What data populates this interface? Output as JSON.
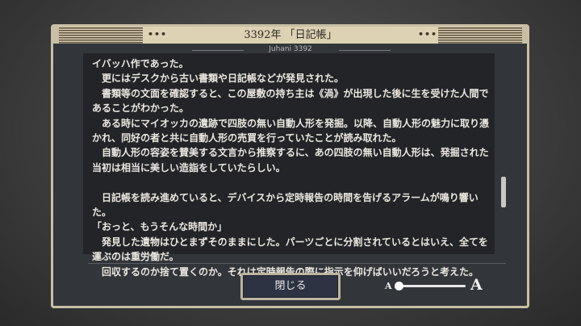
{
  "dialog": {
    "title": "3392年 「日記帳」",
    "subtitle": "Juhani 3392",
    "paragraphs": [
      "イバッハ作であった。",
      "　更にはデスクから古い書類や日記帳などが発見された。",
      "　書類等の文面を確認すると、この屋敷の持ち主は《渦》が出現した後に生を受けた人間であることがわかった。",
      "　ある時にマイオッカの遺跡で四肢の無い自動人形を発掘。以降、自動人形の魅力に取り憑かれ、同好の者と共に自動人形の売買を行っていたことが読み取れた。",
      "　自動人形の容姿を賛美する文言から推察するに、あの四肢の無い自動人形は、発掘された当初は相当に美しい造詣をしていたらしい。",
      "",
      "　日記帳を読み進めていると、デバイスから定時報告の時間を告げるアラームが鳴り響いた。",
      "「おっと、もうそんな時間か」",
      "　発見した遺物はひとまずそのままにした。パーツごとに分割されているとはいえ、全てを運ぶのは重労働だ。",
      "　回収するのか捨て置くのか。それは定時報告の際に指示を仰げばいいだろうと考えた。"
    ],
    "close_label": "閉じる",
    "font_size_small_label": "A",
    "font_size_large_label": "A",
    "font_size_level": 0.0,
    "scroll_position": 0.62
  },
  "colors": {
    "frame": "#c8bfa4",
    "panel": "#32353a",
    "textbox": "#222428",
    "button": "#2d3342"
  }
}
